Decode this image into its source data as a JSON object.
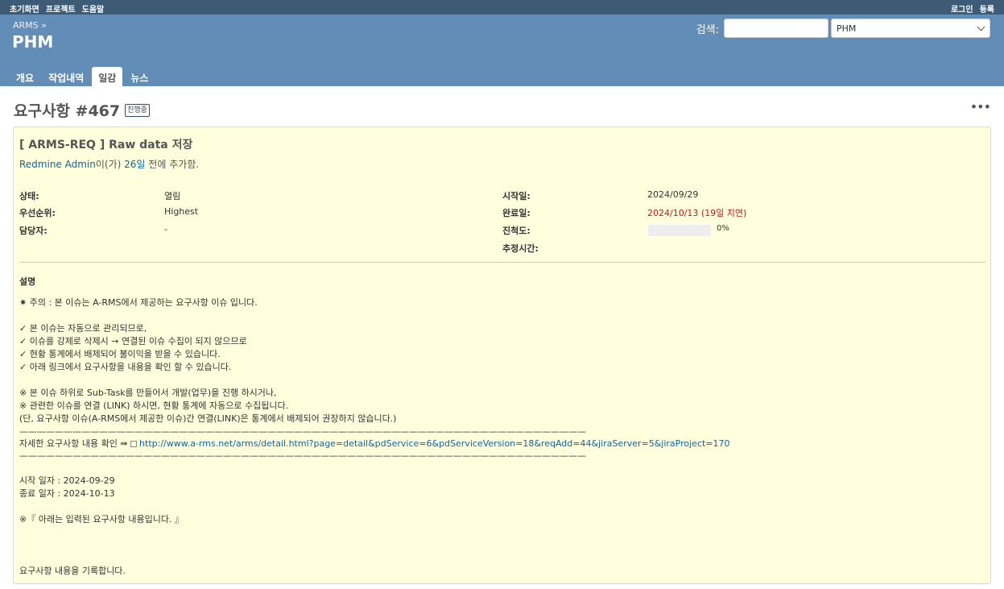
{
  "top_menu": {
    "left": [
      "초기화면",
      "프로젝트",
      "도움말"
    ],
    "right": [
      "로그인",
      "등록"
    ]
  },
  "header": {
    "breadcrumb": "ARMS »",
    "title": "PHM",
    "search_label": "검색:",
    "search_value": "",
    "project_select_value": "PHM"
  },
  "tabs": [
    "개요",
    "작업내역",
    "일감",
    "뉴스"
  ],
  "selected_tab": "일감",
  "issue": {
    "heading": "요구사항 #467",
    "status_badge": "진행중",
    "subject": "[ ARMS-REQ ] Raw data 저장",
    "author": "Redmine Admin",
    "author_suffix": "이(가)",
    "age": "26일",
    "age_suffix": "전에 추가함.",
    "attributes_left": [
      {
        "label": "상태:",
        "value": "열림"
      },
      {
        "label": "우선순위:",
        "value": "Highest"
      },
      {
        "label": "담당자:",
        "value": "-"
      }
    ],
    "attributes_right": [
      {
        "label": "시작일:",
        "value": "2024/09/29"
      },
      {
        "label": "완료일:",
        "value": "2024/10/13 (19일 지연)"
      },
      {
        "label": "진척도:",
        "value": "0%"
      },
      {
        "label": "추정시간:",
        "value": ""
      }
    ],
    "progress_percent": 0,
    "description_label": "설명",
    "description": {
      "notice": "✷ 주의 : 본 이슈는 A-RMS에서 제공하는 요구사항 이슈 입니다.",
      "checks": [
        "✓ 본 이슈는 자동으로 관리되므로,",
        "✓ 이슈를 강제로 삭제시 → 연결된 이슈 수집이 되지 않으므로",
        "✓ 현황 통계에서 배제되어 불이익을 받을 수 있습니다.",
        "✓ 아래 링크에서 요구사항을 내용을 확인 할 수 있습니다."
      ],
      "notes": [
        "※ 본 이슈 하위로 Sub-Task를 만들어서 개발(업무)을 진행 하시거나,",
        "※ 관련한 이슈를 연결 (LINK) 하시면, 현황 통계에 자동으로 수집됩니다.",
        "(단, 요구사항 이슈(A-RMS에서 제공한 이슈)간 연결(LINK)은 통계에서 배제되어 권장하지 않습니다.)"
      ],
      "rule": "————————————————————————————————————————————————————————————————",
      "link_prefix": "자세한 요구사항 내용 확인 ⇛",
      "link_url": "http://www.a-rms.net/arms/detail.html?page=detail&pdService=6&pdServiceVersion=18&reqAdd=44&jiraServer=5&jiraProject=170",
      "start_date": "시작 일자 : 2024-09-29",
      "end_date": "종료 일자 : 2024-10-13",
      "content_notice": "※『 아래는 입력된 요구사항 내용입니다. 』",
      "content": "요구사항 내용을 기록합니다."
    }
  }
}
